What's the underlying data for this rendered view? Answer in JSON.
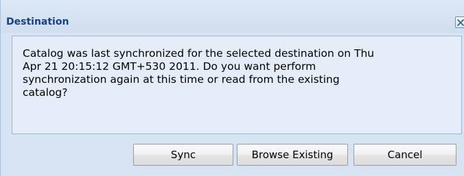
{
  "dialog": {
    "title": "Destination",
    "message": "Catalog was last synchronized for the selected destination on Thu\nApr 21 20:15:12 GMT+530 2011. Do you want perform\nsynchronization again at this time or read from the existing\ncatalog?",
    "close_icon": "close-x-icon"
  },
  "buttons": {
    "sync_label": "Sync",
    "browse_label": "Browse Existing",
    "cancel_label": "Cancel"
  },
  "colors": {
    "title_text": "#15428b",
    "dialog_background": "#d6e3f2",
    "message_background": "#e3ecf7",
    "message_border": "#9cb6d6"
  }
}
